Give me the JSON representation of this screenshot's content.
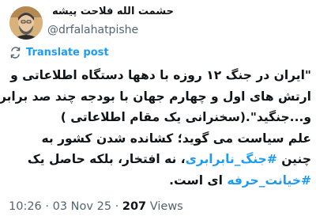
{
  "author": {
    "display_name": "حشمت الله فلاحت پیشه",
    "handle": "@drfalahatpishe"
  },
  "translate": {
    "label": "Translate post",
    "icon": "translate-icon"
  },
  "tweet": {
    "line1": "\"ایران در جنگ ۱۲ روزه با دهها دستگاه اطلاعاتی و",
    "line2": "ارتش های اول و چهارم جهان با بودجه چند صد برابری",
    "line3": "و...جنگید\".(سخنرانی یک مقام اطلاعاتی )",
    "line4": "علم سیاست می گوید؛ کشانده شدن کشور به",
    "line5_pre": "چنین ",
    "hashtag1": "#جنگ_نابرابری",
    "line5_post": "، نه افتخار، بلکه حاصل یک",
    "hashtag2": "#خیانت_حرفه",
    "line6_post": " ای است."
  },
  "meta": {
    "time": "10:26",
    "sep1": " · ",
    "date": "03 Nov 25",
    "sep2": " · ",
    "views_count": "207",
    "views_label": " Views"
  },
  "colors": {
    "link": "#1d9bf0",
    "text": "#0f1419",
    "secondary": "#536471"
  }
}
